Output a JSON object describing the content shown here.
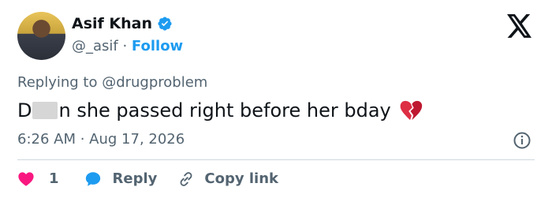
{
  "author": {
    "name": "Asif Khan",
    "handle": "@_asif",
    "separator": " · ",
    "follow_label": "Follow"
  },
  "replying_to": "Replying to @drugproblem",
  "tweet": {
    "text_prefix": "D",
    "text_suffix": "n she passed right before her bday"
  },
  "meta": {
    "time": "6:26 AM",
    "separator": " · ",
    "date": "Aug 17, 2026"
  },
  "actions": {
    "like_count": "1",
    "reply_label": "Reply",
    "copy_label": "Copy link"
  },
  "colors": {
    "accent": "#1d9bf0",
    "like": "#f91880",
    "muted": "#536471"
  }
}
